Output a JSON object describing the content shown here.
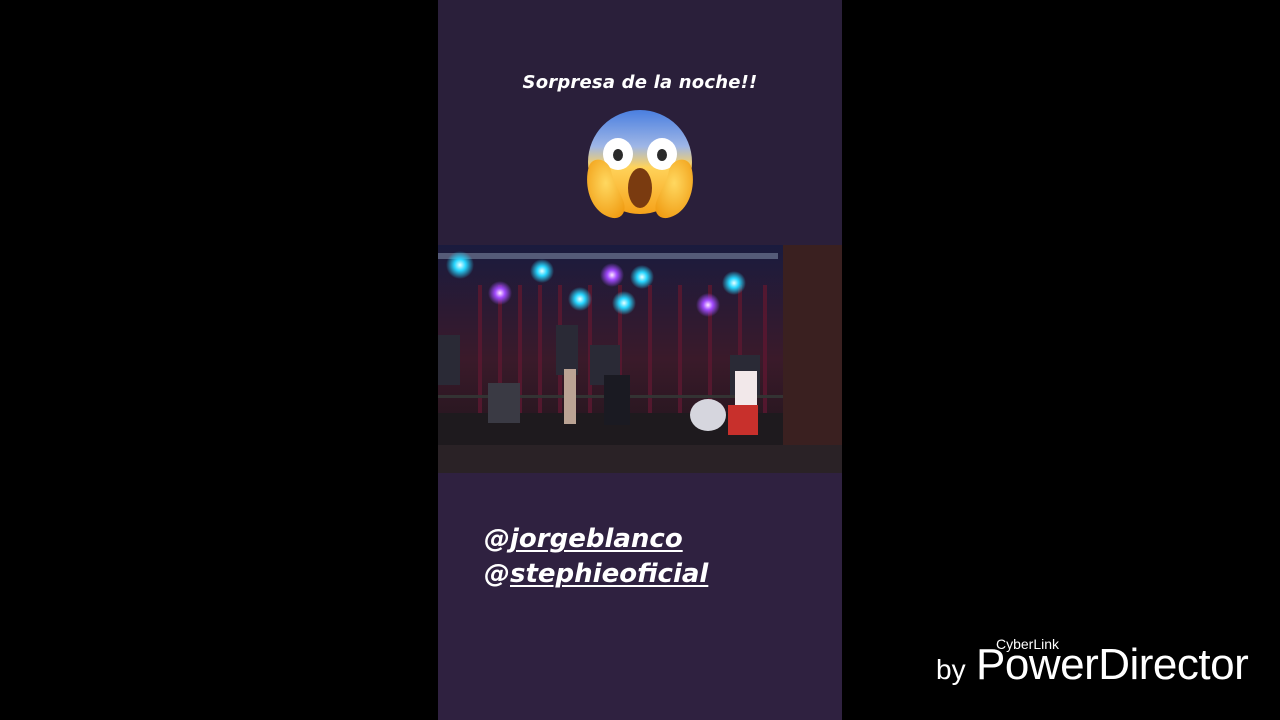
{
  "story": {
    "caption": "Sorpresa de la noche!!",
    "emoji": "face-screaming-in-fear-icon",
    "mentions": [
      {
        "at": "@",
        "handle": "jorgeblanco"
      },
      {
        "at": "@",
        "handle": "stephieoficial"
      }
    ]
  },
  "watermark": {
    "by": "by",
    "brand": "PowerDirector",
    "maker": "CyberLink"
  },
  "colors": {
    "background": "#000000",
    "story_top": "#2a1f3a",
    "story_bottom": "#2f2140",
    "text": "#ffffff"
  }
}
